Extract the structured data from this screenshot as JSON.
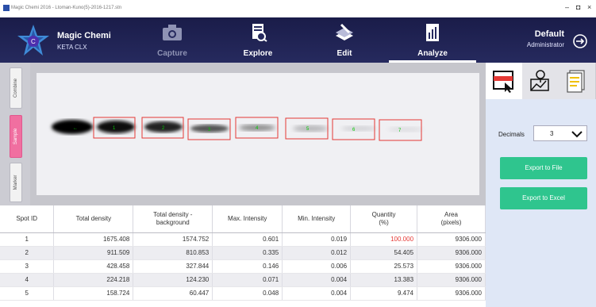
{
  "window": {
    "title": "Magic Chemi 2016 - Ltoman-Kuno(5)-2016-1217.stn",
    "minimize": "–",
    "maximize": "◘",
    "close": "×"
  },
  "app": {
    "name": "Magic Chemi",
    "subtitle": "KETA CLX"
  },
  "tabs": [
    {
      "label": "Capture",
      "icon": "camera-icon",
      "state": "disabled"
    },
    {
      "label": "Explore",
      "icon": "explore-icon",
      "state": "normal"
    },
    {
      "label": "Edit",
      "icon": "edit-icon",
      "state": "normal"
    },
    {
      "label": "Analyze",
      "icon": "analyze-icon",
      "state": "active"
    }
  ],
  "user": {
    "name": "Default",
    "role": "Administrator"
  },
  "side_tabs": [
    {
      "label": "Combine",
      "active": false
    },
    {
      "label": "Sample",
      "active": true
    },
    {
      "label": "Marker",
      "active": false
    }
  ],
  "gel": {
    "spot_labels": [
      "1",
      "2",
      "3",
      "4",
      "5",
      "6",
      "7"
    ]
  },
  "table": {
    "headers": [
      "Spot ID",
      "Total density",
      "Total density -\nbackground",
      "Max. Intensity",
      "Min. Intensity",
      "Quantity\n(%)",
      "Area\n(pixels)"
    ],
    "rows": [
      [
        "1",
        "1675.408",
        "1574.752",
        "0.601",
        "0.019",
        "100.000",
        "9306.000"
      ],
      [
        "2",
        "911.509",
        "810.853",
        "0.335",
        "0.012",
        "54.405",
        "9306.000"
      ],
      [
        "3",
        "428.458",
        "327.844",
        "0.146",
        "0.006",
        "25.573",
        "9306.000"
      ],
      [
        "4",
        "224.218",
        "124.230",
        "0.071",
        "0.004",
        "13.383",
        "9306.000"
      ],
      [
        "5",
        "158.724",
        "60.447",
        "0.048",
        "0.004",
        "9.474",
        "9306.000"
      ]
    ]
  },
  "right_panel": {
    "decimals_label": "Decimals",
    "decimals_value": "3",
    "export_file_label": "Export to File",
    "export_excel_label": "Export to Excel"
  },
  "colors": {
    "header_bg": "#1a1c49",
    "accent_green": "#2fc58e",
    "highlight_red": "#e53935",
    "sample_tab": "#f06fa0",
    "spot_label_green": "#00c800",
    "spot_box_red": "#e53935"
  }
}
